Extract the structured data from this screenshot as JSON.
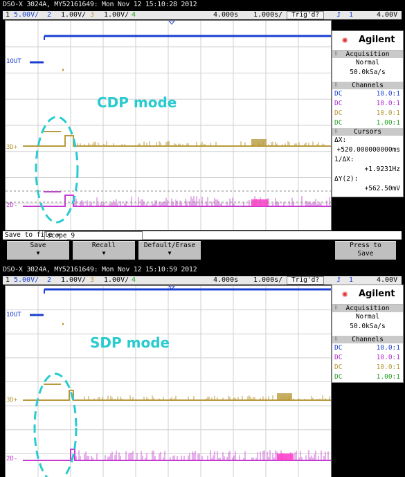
{
  "screens": [
    {
      "title": "DSO-X 3024A, MY52161649: Mon Nov 12 15:10:28 2012",
      "settings": {
        "ch1_num": "1",
        "ch1_scale": "5.00V/",
        "ch2_num": "2",
        "ch2_scale": "1.00V/",
        "ch3_num": "3",
        "ch3_scale": "1.00V/",
        "ch4_num": "4",
        "time_delay": "4.000s",
        "time_base": "1.000s/",
        "trig_state": "Trig'd?",
        "trig_src": "1",
        "trig_level": "4.00V"
      },
      "labels": {
        "ch1": "OUT",
        "ch2": "D+",
        "ch3": "D-"
      },
      "annotation": "CDP mode",
      "panel": {
        "brand": "Agilent",
        "acquisition_header": "Acquisition",
        "acq_mode": "Normal",
        "acq_rate": "50.0kSa/s",
        "channels_header": "Channels",
        "channels": [
          {
            "coupling": "DC",
            "probe": "10.0:1",
            "color": "#1a3fd0"
          },
          {
            "coupling": "DC",
            "probe": "10.0:1",
            "color": "#b02bd0"
          },
          {
            "coupling": "DC",
            "probe": "10.0:1",
            "color": "#b89a3c"
          },
          {
            "coupling": "DC",
            "probe": "1.00:1",
            "color": "#2aa02a"
          }
        ],
        "cursors_header": "Cursors",
        "dx_label": "ΔX:",
        "dx_value": "+520.000000000ms",
        "inv_dx_label": "1/ΔX:",
        "inv_dx_value": "+1.9231Hz",
        "dy_label": "ΔY(2):",
        "dy_value": "+562.50mV"
      },
      "save": {
        "label": "Save to file =",
        "filename": "scope_9"
      },
      "softkeys": {
        "save": "Save",
        "recall": "Recall",
        "default": "Default/Erase",
        "press_line1": "Press to",
        "press_line2": "Save"
      }
    },
    {
      "title": "DSO-X 3024A, MY52161649: Mon Nov 12 15:10:59 2012",
      "settings": {
        "ch1_num": "1",
        "ch1_scale": "5.00V/",
        "ch2_num": "2",
        "ch2_scale": "1.00V/",
        "ch3_num": "3",
        "ch3_scale": "1.00V/",
        "ch4_num": "4",
        "time_delay": "4.000s",
        "time_base": "1.000s/",
        "trig_state": "Trig'd?",
        "trig_src": "1",
        "trig_level": "4.00V"
      },
      "labels": {
        "ch1": "OUT",
        "ch2": "D+",
        "ch3": "D-"
      },
      "annotation": "SDP mode",
      "panel": {
        "brand": "Agilent",
        "acquisition_header": "Acquisition",
        "acq_mode": "Normal",
        "acq_rate": "50.0kSa/s",
        "channels_header": "Channels",
        "channels": [
          {
            "coupling": "DC",
            "probe": "10.0:1",
            "color": "#1a3fd0"
          },
          {
            "coupling": "DC",
            "probe": "10.0:1",
            "color": "#b02bd0"
          },
          {
            "coupling": "DC",
            "probe": "10.0:1",
            "color": "#b89a3c"
          },
          {
            "coupling": "DC",
            "probe": "1.00:1",
            "color": "#2aa02a"
          }
        ]
      }
    }
  ],
  "colors": {
    "ch1": "#1a3fd0",
    "ch2": "#b89a3c",
    "ch3": "#c43cd0",
    "ch3_burst": "#ff44cc",
    "annotation": "#29cbd0",
    "grid": "#cfcfcf"
  },
  "icons": {
    "brand_logo": "agilent-spark-icon",
    "trigger_edge": "rising-edge-icon"
  }
}
